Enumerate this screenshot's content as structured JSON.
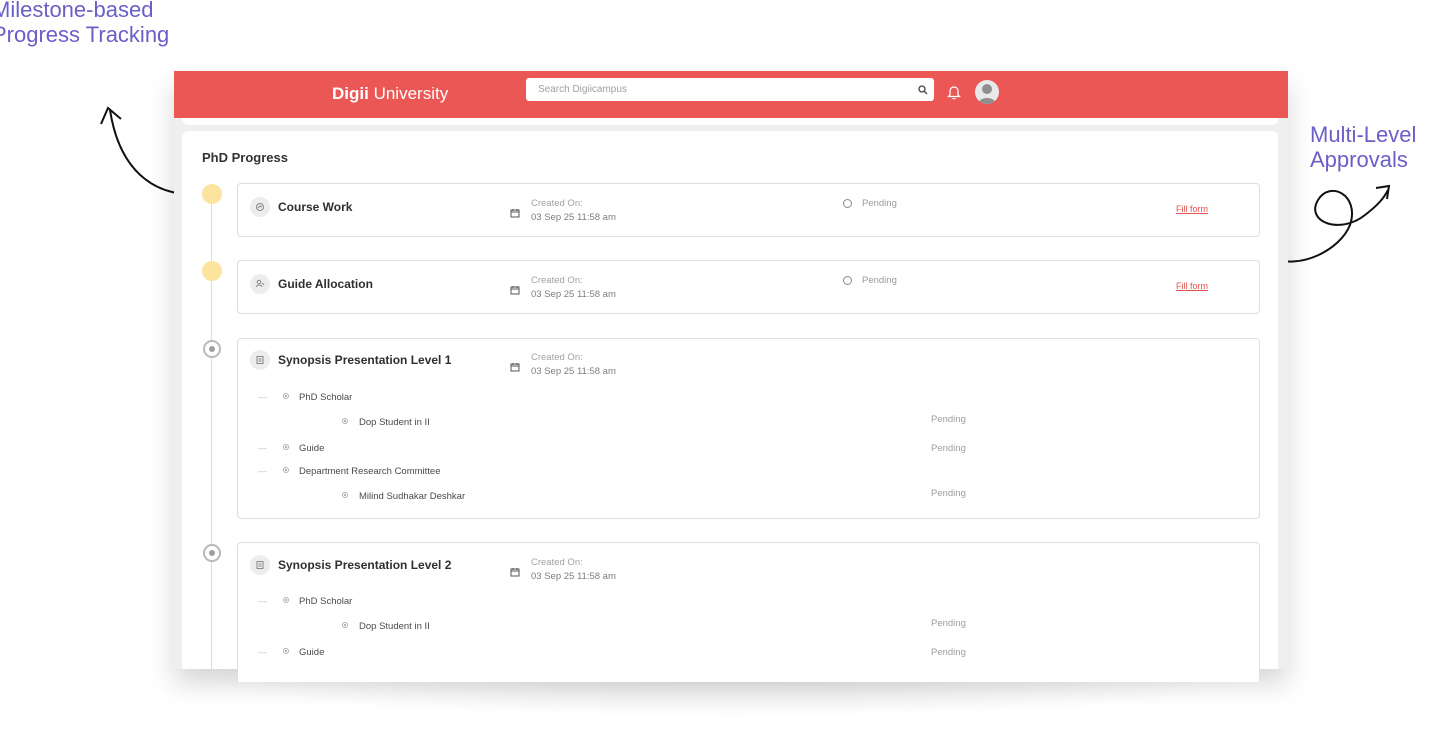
{
  "callouts": {
    "left": {
      "line1": "Milestone-based",
      "line2": "Progress Tracking"
    },
    "right": {
      "line1": "Multi-Level",
      "line2": "Approvals"
    }
  },
  "colors": {
    "accent": "#ea5754",
    "callout": "#6b5fc7",
    "pending_dot": "#fde49e"
  },
  "header": {
    "brand_bold": "Digii",
    "brand_rest": " University",
    "search_placeholder": "Search Digiicampus",
    "icons": [
      "search-icon",
      "bell-icon",
      "avatar"
    ]
  },
  "page": {
    "title": "PhD Progress"
  },
  "milestones": [
    {
      "title": "Course Work",
      "icon": "coursework-icon",
      "created_label": "Created On:",
      "created_date": "03 Sep 25 11:58 am",
      "status": "Pending",
      "action": "Fill form"
    },
    {
      "title": "Guide Allocation",
      "icon": "guide-icon",
      "created_label": "Created On:",
      "created_date": "03 Sep 25 11:58 am",
      "status": "Pending",
      "action": "Fill form"
    },
    {
      "title": "Synopsis Presentation Level 1",
      "icon": "document-icon",
      "created_label": "Created On:",
      "created_date": "03 Sep 25 11:58 am",
      "approvals": [
        {
          "role": "PhD Scholar",
          "members": [
            {
              "name": "Dop Student in II",
              "status": "Pending"
            }
          ]
        },
        {
          "role": "Guide",
          "status": "Pending"
        },
        {
          "role": "Department Research Committee",
          "members": [
            {
              "name": "Milind Sudhakar Deshkar",
              "status": "Pending"
            }
          ]
        }
      ]
    },
    {
      "title": "Synopsis Presentation Level 2",
      "icon": "document-icon",
      "created_label": "Created On:",
      "created_date": "03 Sep 25 11:58 am",
      "approvals": [
        {
          "role": "PhD Scholar",
          "members": [
            {
              "name": "Dop Student in II",
              "status": "Pending"
            }
          ]
        },
        {
          "role": "Guide",
          "status": "Pending"
        }
      ]
    }
  ]
}
